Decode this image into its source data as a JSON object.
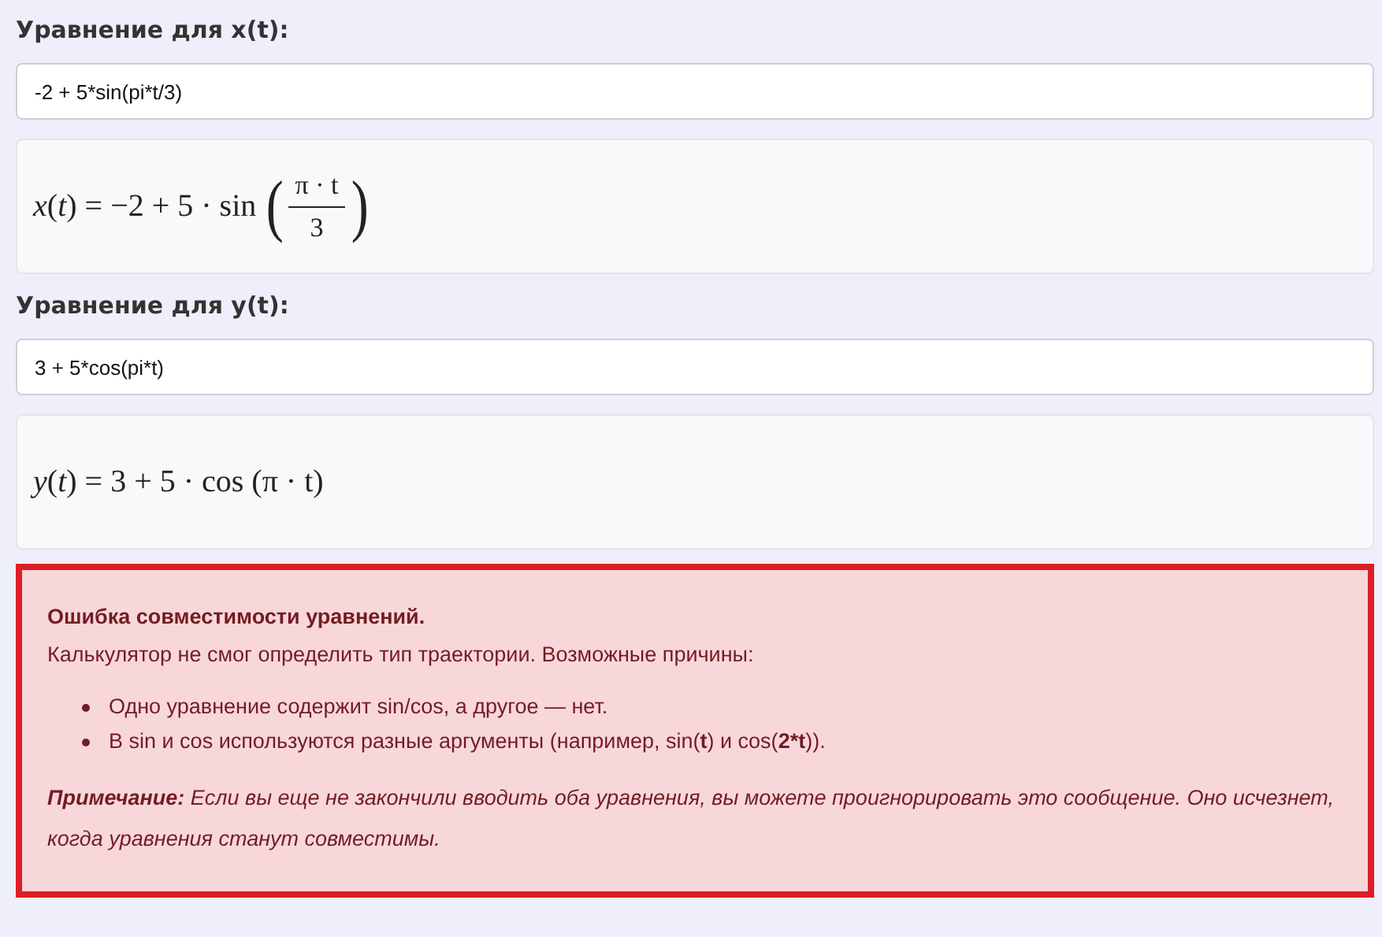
{
  "equations": [
    {
      "label": "Уравнение для x(t):",
      "value": "-2 + 5*sin(pi*t/3)",
      "formula": [
        {
          "kind": "text",
          "text": "*x*(*t*) = −2 + 5 · sin"
        },
        {
          "kind": "frac",
          "open": "(",
          "num": "π · t",
          "den": "3",
          "close": ")"
        }
      ]
    },
    {
      "label": "Уравнение для y(t):",
      "value": "3 + 5*cos(pi*t)",
      "formula": [
        {
          "kind": "text",
          "text": "*y*(*t*) = 3 + 5 · cos (π · t)"
        }
      ]
    }
  ],
  "error": {
    "title": "Ошибка совместимости уравнений.",
    "text": "Калькулятор не смог определить тип траектории. Возможные причины:",
    "reasons": [
      "Одно уравнение содержит sin/cos, а другое — нет.",
      "В sin и cos используются разные аргументы (например, sin(**t**) и cos(**2*t**))."
    ],
    "note": "**Примечание:** Если вы еще не закончили вводить оба уравнения, вы можете проигнорировать это сообщение. Оно исчезнет, когда уравнения станут совместимы."
  }
}
